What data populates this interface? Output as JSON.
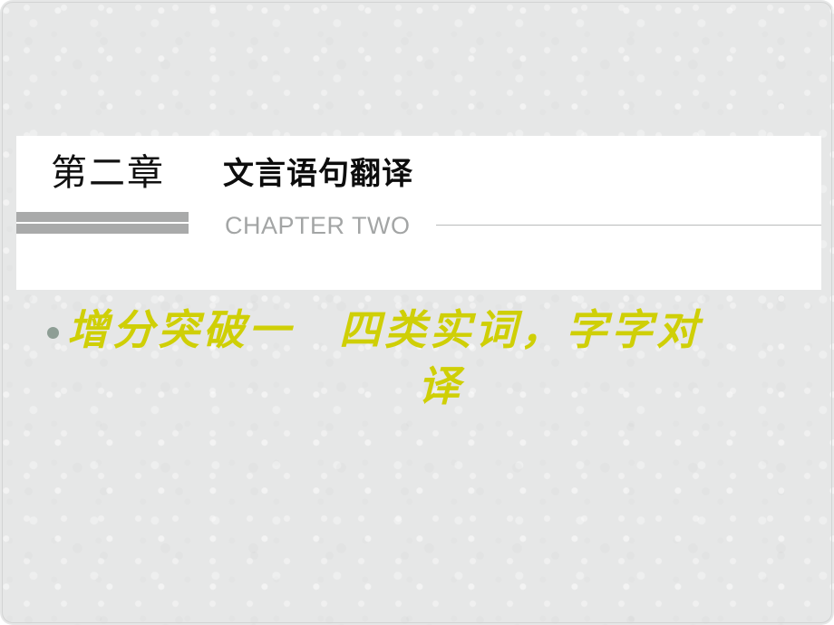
{
  "slide": {
    "background_color": "#e6e7e7",
    "panel_color": "#ffffff",
    "accent_yellow": "#cfcf06",
    "accent_gray": "#a9aaaa",
    "subtitle_gray": "#a3a5a5",
    "bullet_color": "#8e9e95"
  },
  "chapter": {
    "number_cn": "第二章",
    "subject_cn": "文言语句翻译",
    "number_en": "CHAPTER TWO"
  },
  "headline": {
    "line1": "增分突破一　四类实词，字字对",
    "line2": "译",
    "full_text": "增分突破一　四类实词，字字对译"
  }
}
